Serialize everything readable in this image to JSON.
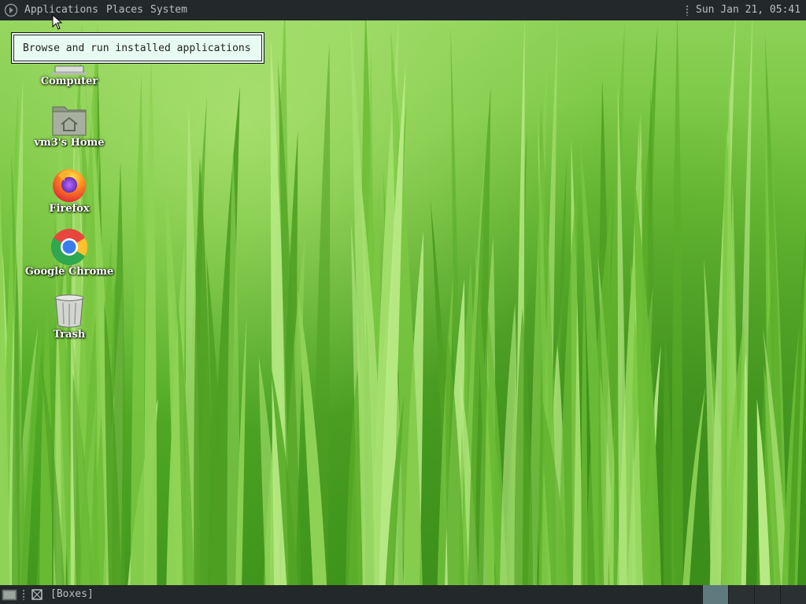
{
  "top_panel": {
    "menus": [
      "Applications",
      "Places",
      "System"
    ],
    "clock": "Sun Jan 21, 05:41"
  },
  "tooltip": {
    "text": "Browse and run installed applications"
  },
  "desktop_icons": [
    {
      "label": "Computer",
      "icon": "computer-icon"
    },
    {
      "label": "vm3's Home",
      "icon": "home-folder-icon"
    },
    {
      "label": "Firefox",
      "icon": "firefox-icon"
    },
    {
      "label": "Google Chrome",
      "icon": "chrome-icon"
    },
    {
      "label": "Trash",
      "icon": "trash-icon"
    }
  ],
  "bottom_panel": {
    "window_button": "[Boxes]",
    "workspace_count": 4,
    "active_workspace": 1
  },
  "colors": {
    "panel_bg": "#23282a",
    "panel_text": "#b8c0c2",
    "tooltip_bg": "#e8fbf2",
    "active_workspace": "#5f7a7f"
  }
}
